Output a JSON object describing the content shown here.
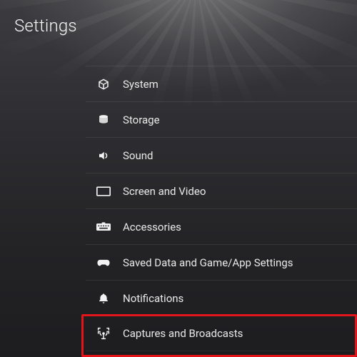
{
  "header": {
    "title": "Settings"
  },
  "menu": {
    "items": [
      {
        "label": "System"
      },
      {
        "label": "Storage"
      },
      {
        "label": "Sound"
      },
      {
        "label": "Screen and Video"
      },
      {
        "label": "Accessories"
      },
      {
        "label": "Saved Data and Game/App Settings"
      },
      {
        "label": "Notifications"
      },
      {
        "label": "Captures and Broadcasts"
      }
    ],
    "highlight_index": 7
  }
}
